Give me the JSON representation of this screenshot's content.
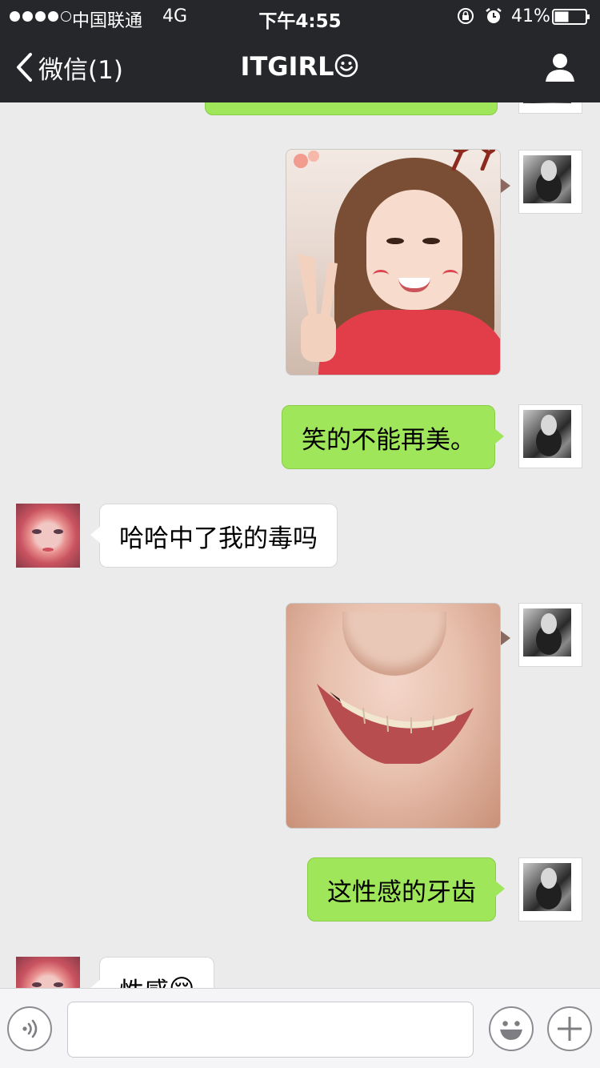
{
  "status_bar": {
    "carrier": "中国联通",
    "network": "4G",
    "time": "下午4:55",
    "battery": "41%",
    "battery_level": 0.41,
    "signal_bars_filled": 4,
    "signal_bars_total": 5
  },
  "nav": {
    "back_label": "微信(1)",
    "title": "ITGIRL"
  },
  "messages": [
    {
      "sender": "me",
      "type": "text",
      "text": ""
    },
    {
      "sender": "me",
      "type": "image",
      "icon": "selfie-photo"
    },
    {
      "sender": "me",
      "type": "text",
      "text": "笑的不能再美。"
    },
    {
      "sender": "her",
      "type": "text",
      "text": "哈哈中了我的毒吗"
    },
    {
      "sender": "me",
      "type": "image",
      "icon": "smile-teeth-photo"
    },
    {
      "sender": "me",
      "type": "text",
      "text": "这性感的牙齿"
    },
    {
      "sender": "her",
      "type": "text",
      "text": "性感",
      "emoji": "😌"
    }
  ],
  "input_bar": {
    "text_value": "",
    "placeholder": ""
  },
  "colors": {
    "nav_bg": "#26272b",
    "chat_bg": "#ebebeb",
    "outgoing_bubble": "#9fe65b",
    "incoming_bubble": "#ffffff"
  }
}
